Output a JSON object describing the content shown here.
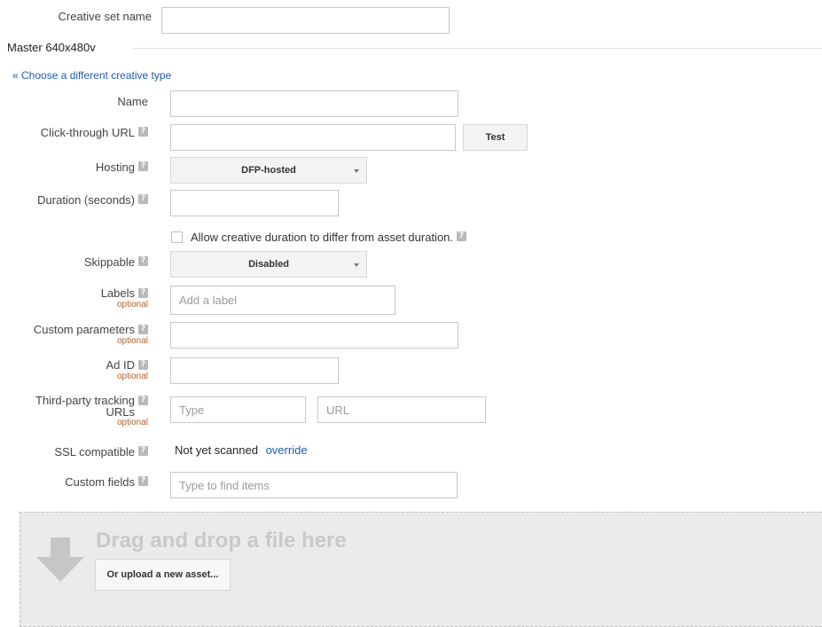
{
  "creative_set": {
    "label": "Creative set name",
    "value": ""
  },
  "section": {
    "title": "Master 640x480v",
    "change_type_link": "« Choose a different creative type"
  },
  "help_glyph": "?",
  "optional_text": "optional",
  "fields": {
    "name": {
      "label": "Name",
      "value": ""
    },
    "click_through": {
      "label": "Click-through URL",
      "value": "",
      "test_button": "Test"
    },
    "hosting": {
      "label": "Hosting",
      "selected": "DFP-hosted"
    },
    "duration": {
      "label": "Duration (seconds)",
      "value": ""
    },
    "allow_duration": {
      "label": "Allow creative duration to differ from asset duration.",
      "checked": false
    },
    "skippable": {
      "label": "Skippable",
      "selected": "Disabled"
    },
    "labels": {
      "label": "Labels",
      "placeholder": "Add a label"
    },
    "custom_params": {
      "label": "Custom parameters",
      "value": ""
    },
    "ad_id": {
      "label": "Ad ID",
      "value": ""
    },
    "third_party": {
      "label_line1": "Third-party tracking",
      "label_line2": "URLs",
      "type_placeholder": "Type",
      "url_placeholder": "URL"
    },
    "ssl": {
      "label": "SSL compatible",
      "status": "Not yet scanned",
      "override_link": "override"
    },
    "custom_fields": {
      "label": "Custom fields",
      "placeholder": "Type to find items"
    }
  },
  "dropzone": {
    "title": "Drag and drop a file here",
    "upload_button": "Or upload a new asset..."
  },
  "colors": {
    "link": "#1e5cb3",
    "optional": "#b0632e",
    "help_icon": "#b9b9b9"
  }
}
